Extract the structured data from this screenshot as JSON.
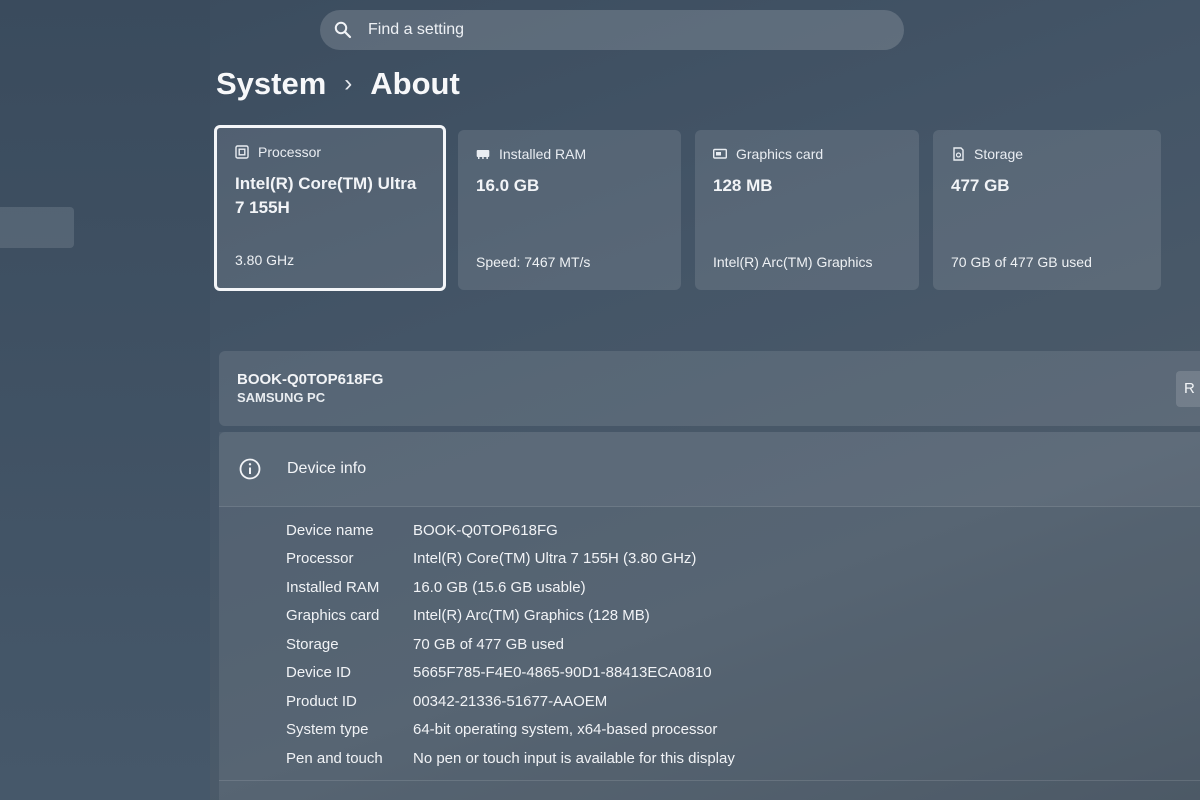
{
  "search": {
    "placeholder": "Find a setting",
    "icon": "search-icon"
  },
  "breadcrumb": {
    "parent": "System",
    "separator": "›",
    "current": "About"
  },
  "cards": [
    {
      "title": "Processor",
      "icon": "processor-icon",
      "main_line1": "Intel(R) Core(TM) Ultra",
      "main_line2": "7 155H",
      "sub": "3.80 GHz",
      "selected": true
    },
    {
      "title": "Installed RAM",
      "icon": "ram-icon",
      "main_line1": "16.0 GB",
      "main_line2": "",
      "sub": "Speed: 7467 MT/s"
    },
    {
      "title": "Graphics card",
      "icon": "graphics-card-icon",
      "main_line1": "128 MB",
      "main_line2": "",
      "sub": "Intel(R) Arc(TM) Graphics"
    },
    {
      "title": "Storage",
      "icon": "storage-icon",
      "main_line1": "477 GB",
      "main_line2": "",
      "sub": "70 GB of 477 GB used"
    }
  ],
  "device": {
    "name": "BOOK-Q0TOP618FG",
    "model": "SAMSUNG PC",
    "rename_label": "R"
  },
  "device_info": {
    "title": "Device info",
    "icon": "info-icon",
    "specs": [
      {
        "label": "Device name",
        "value": "BOOK-Q0TOP618FG"
      },
      {
        "label": "Processor",
        "value": "Intel(R) Core(TM) Ultra 7 155H (3.80 GHz)"
      },
      {
        "label": "Installed RAM",
        "value": "16.0 GB (15.6 GB usable)"
      },
      {
        "label": "Graphics card",
        "value": "Intel(R) Arc(TM) Graphics (128 MB)"
      },
      {
        "label": "Storage",
        "value": "70 GB of 477 GB used"
      },
      {
        "label": "Device ID",
        "value": "5665F785-F4E0-4865-90D1-88413ECA0810"
      },
      {
        "label": "Product ID",
        "value": "00342-21336-51677-AAOEM"
      },
      {
        "label": "System type",
        "value": "64-bit operating system, x64-based processor"
      },
      {
        "label": "Pen and touch",
        "value": "No pen or touch input is available for this display"
      }
    ]
  }
}
